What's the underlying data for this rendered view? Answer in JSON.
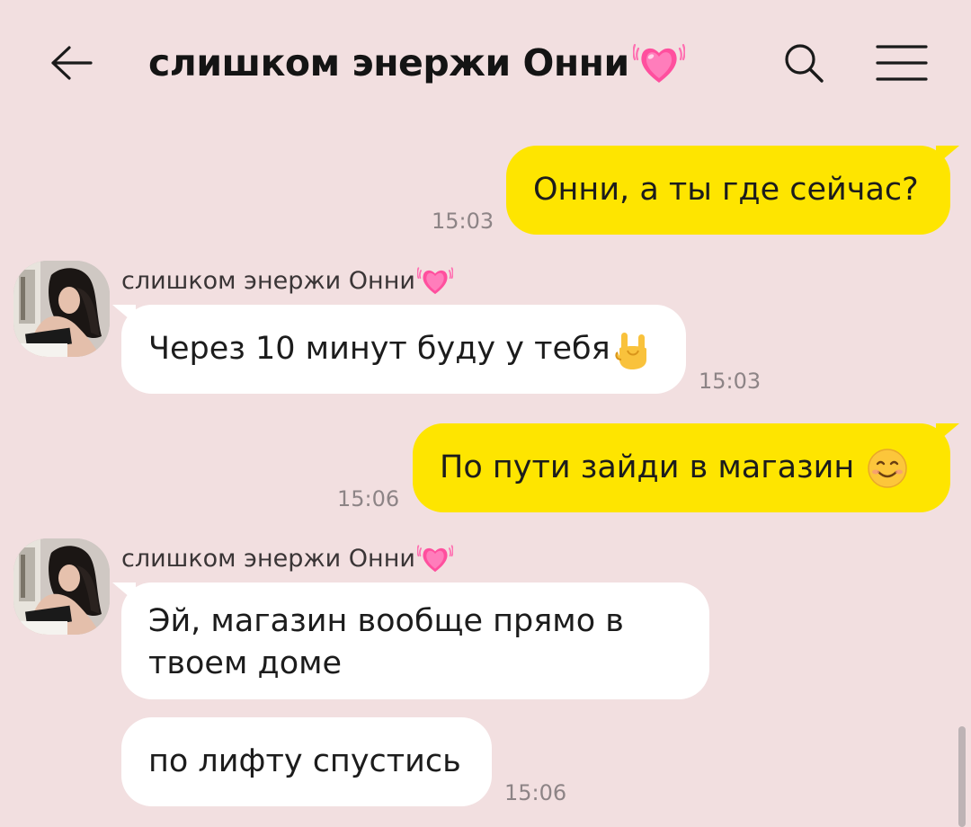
{
  "header": {
    "title": "слишком энержи Онни",
    "title_emoji": "growing-heart-icon"
  },
  "colors": {
    "background": "#f2dfe0",
    "outgoing_bubble": "#fee500",
    "incoming_bubble": "#ffffff",
    "timestamp": "#8d8486"
  },
  "messages": [
    {
      "id": "m1",
      "direction": "out",
      "text": "Онни, а ты где сейчас?",
      "time": "15:03"
    },
    {
      "id": "m2",
      "direction": "in",
      "sender": "слишком энержи Онни",
      "text": "Через 10 минут буду у тебя",
      "emoji": "sign-of-horns-icon",
      "time": "15:03"
    },
    {
      "id": "m3",
      "direction": "out",
      "text": "По пути зайди в магазин",
      "emoji": "smiling-face-icon",
      "time": "15:06"
    },
    {
      "id": "m4",
      "direction": "in",
      "sender": "слишком энержи Онни",
      "text_line1": "Эй, магазин вообще прямо в",
      "text_line2": "твоем доме"
    },
    {
      "id": "m5",
      "direction": "in",
      "text": "по лифту спустись",
      "time": "15:06"
    }
  ]
}
